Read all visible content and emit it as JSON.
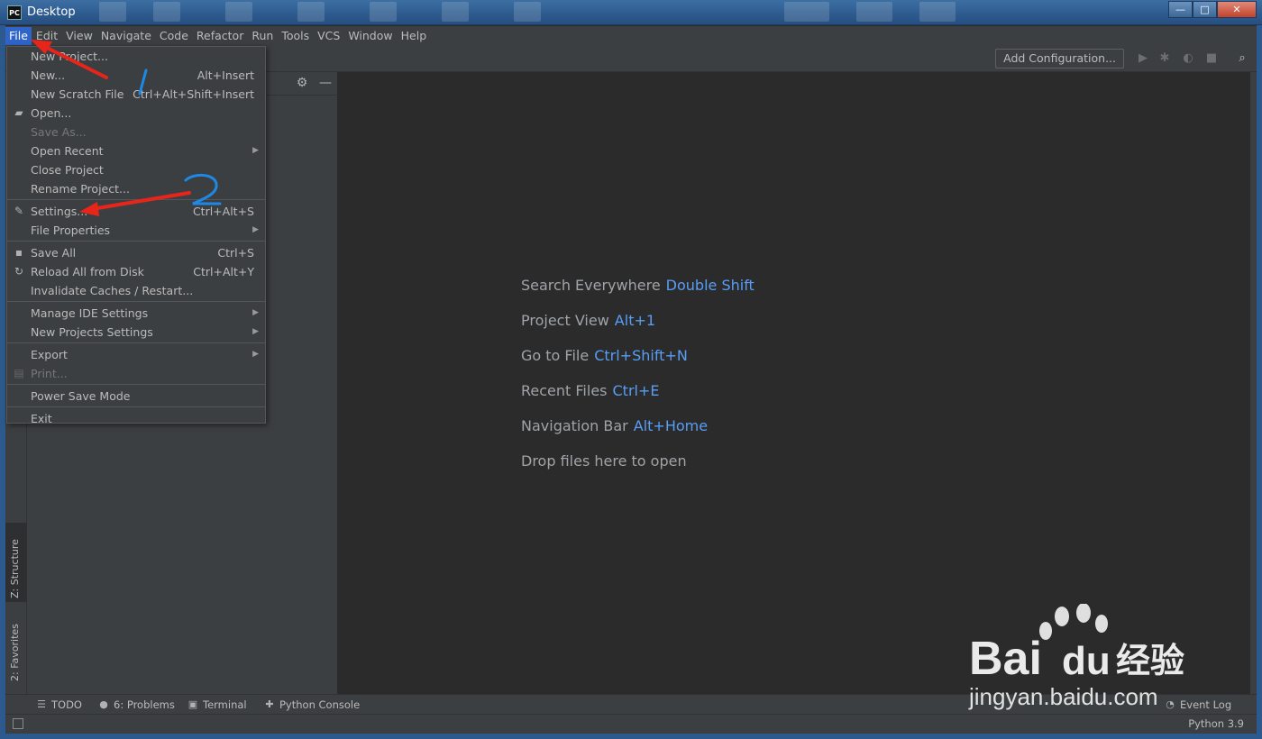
{
  "window": {
    "title": "Desktop",
    "app_icon": "PC",
    "minimize": "—",
    "maximize": "□",
    "close": "✕"
  },
  "menubar": {
    "items": [
      {
        "label": "File",
        "active": true
      },
      {
        "label": "Edit"
      },
      {
        "label": "View"
      },
      {
        "label": "Navigate"
      },
      {
        "label": "Code"
      },
      {
        "label": "Refactor"
      },
      {
        "label": "Run"
      },
      {
        "label": "Tools"
      },
      {
        "label": "VCS"
      },
      {
        "label": "Window"
      },
      {
        "label": "Help"
      }
    ]
  },
  "toolbar": {
    "add_configuration": "Add Configuration..."
  },
  "file_menu": {
    "items": [
      {
        "label": "New Project...",
        "shortcut": ""
      },
      {
        "label": "New...",
        "shortcut": "Alt+Insert"
      },
      {
        "label": "New Scratch File",
        "shortcut": "Ctrl+Alt+Shift+Insert"
      },
      {
        "label": "Open...",
        "shortcut": "",
        "icon": "folder-icon"
      },
      {
        "label": "Save As...",
        "shortcut": "",
        "disabled": true
      },
      {
        "label": "Open Recent",
        "submenu": true
      },
      {
        "label": "Close Project",
        "shortcut": ""
      },
      {
        "label": "Rename Project...",
        "shortcut": ""
      },
      {
        "label": "Settings...",
        "shortcut": "Ctrl+Alt+S",
        "icon": "wrench-icon"
      },
      {
        "label": "File Properties",
        "submenu": true
      },
      {
        "label": "Save All",
        "shortcut": "Ctrl+S",
        "icon": "save-icon"
      },
      {
        "label": "Reload All from Disk",
        "shortcut": "Ctrl+Alt+Y",
        "icon": "reload-icon"
      },
      {
        "label": "Invalidate Caches / Restart...",
        "shortcut": ""
      },
      {
        "label": "Manage IDE Settings",
        "submenu": true
      },
      {
        "label": "New Projects Settings",
        "submenu": true
      },
      {
        "label": "Export",
        "submenu": true
      },
      {
        "label": "Print...",
        "disabled": true,
        "icon": "print-icon"
      },
      {
        "label": "Power Save Mode"
      },
      {
        "label": "Exit"
      }
    ]
  },
  "editor_hints": [
    {
      "label": "Search Everywhere",
      "key": "Double Shift"
    },
    {
      "label": "Project View",
      "key": "Alt+1"
    },
    {
      "label": "Go to File",
      "key": "Ctrl+Shift+N"
    },
    {
      "label": "Recent Files",
      "key": "Ctrl+E"
    },
    {
      "label": "Navigation Bar",
      "key": "Alt+Home"
    },
    {
      "label": "Drop files here to open",
      "key": ""
    }
  ],
  "left_tabs": {
    "structure": "Z: Structure",
    "favorites": "2: Favorites"
  },
  "bottom_tabs": [
    {
      "label": "TODO",
      "icon": "list-icon"
    },
    {
      "label": "6: Problems",
      "icon": "info-icon"
    },
    {
      "label": "Terminal",
      "icon": "terminal-icon"
    },
    {
      "label": "Python Console",
      "icon": "python-icon"
    }
  ],
  "status": {
    "event_log": "Event Log",
    "interpreter": "Python 3.9"
  },
  "annotations": {
    "mark1": "1",
    "mark2": "2"
  },
  "watermark": {
    "brand": "Bai",
    "brand_suffix": "du",
    "cn": "经验",
    "url": "jingyan.baidu.com"
  },
  "colors": {
    "accent": "#2f65ca",
    "hint_key": "#589df6",
    "background": "#2b2b2b",
    "panel": "#3c3f41",
    "arrow": "#e8251b",
    "pen": "#1e88e5"
  }
}
